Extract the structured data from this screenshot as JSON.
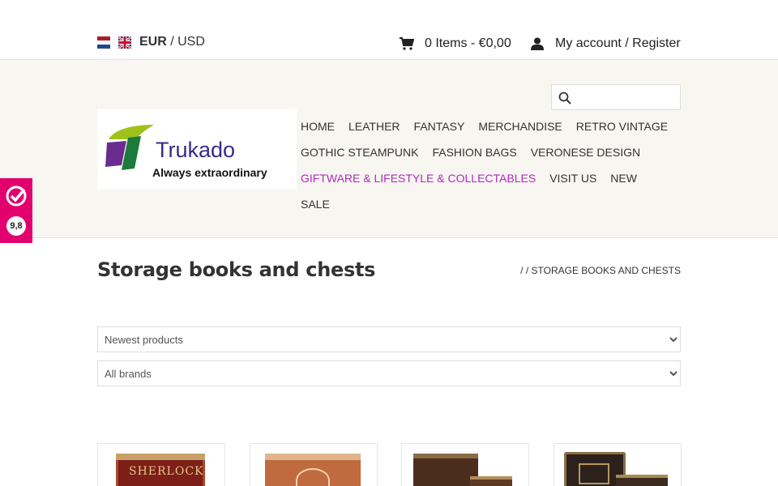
{
  "topbar": {
    "currency_active": "EUR",
    "currency_separator": " / ",
    "currency_other": "USD",
    "cart_label": "0 Items - €0,00",
    "account_label": "My account / Register",
    "icons": {
      "cart": "cart-icon",
      "user": "user-icon",
      "flag_nl": "flag-nl-icon",
      "flag_gb": "flag-gb-icon"
    }
  },
  "header": {
    "logo_name": "Trukado",
    "logo_tagline": "Always extraordinary",
    "search_placeholder": "",
    "nav": [
      {
        "label": "HOME",
        "active": false
      },
      {
        "label": "LEATHER",
        "active": false
      },
      {
        "label": "FANTASY",
        "active": false
      },
      {
        "label": "MERCHANDISE",
        "active": false
      },
      {
        "label": "RETRO VINTAGE",
        "active": false
      },
      {
        "label": "GOTHIC STEAMPUNK",
        "active": false
      },
      {
        "label": "FASHION BAGS",
        "active": false
      },
      {
        "label": "VERONESE DESIGN",
        "active": false
      },
      {
        "label": "GIFTWARE & LIFESTYLE & COLLECTABLES",
        "active": true
      },
      {
        "label": "VISIT US",
        "active": false
      },
      {
        "label": "NEW",
        "active": false
      },
      {
        "label": "SALE",
        "active": false
      }
    ]
  },
  "review_badge": {
    "score": "9,8"
  },
  "main": {
    "title": "Storage books and chests",
    "breadcrumb": "/ / STORAGE BOOKS AND CHESTS",
    "sort_selected": "Newest products",
    "brand_selected": "All brands"
  },
  "products": [
    {
      "image": "sherlock-storage-book",
      "visible_text": "SHERLOCK"
    },
    {
      "image": "ornate-storage-book"
    },
    {
      "image": "brown-storage-books"
    },
    {
      "image": "dark-ornate-storage-books"
    }
  ],
  "colors": {
    "accent": "#b02cbf",
    "header_bg": "#f7f6f1",
    "badge": "#e1006d"
  }
}
